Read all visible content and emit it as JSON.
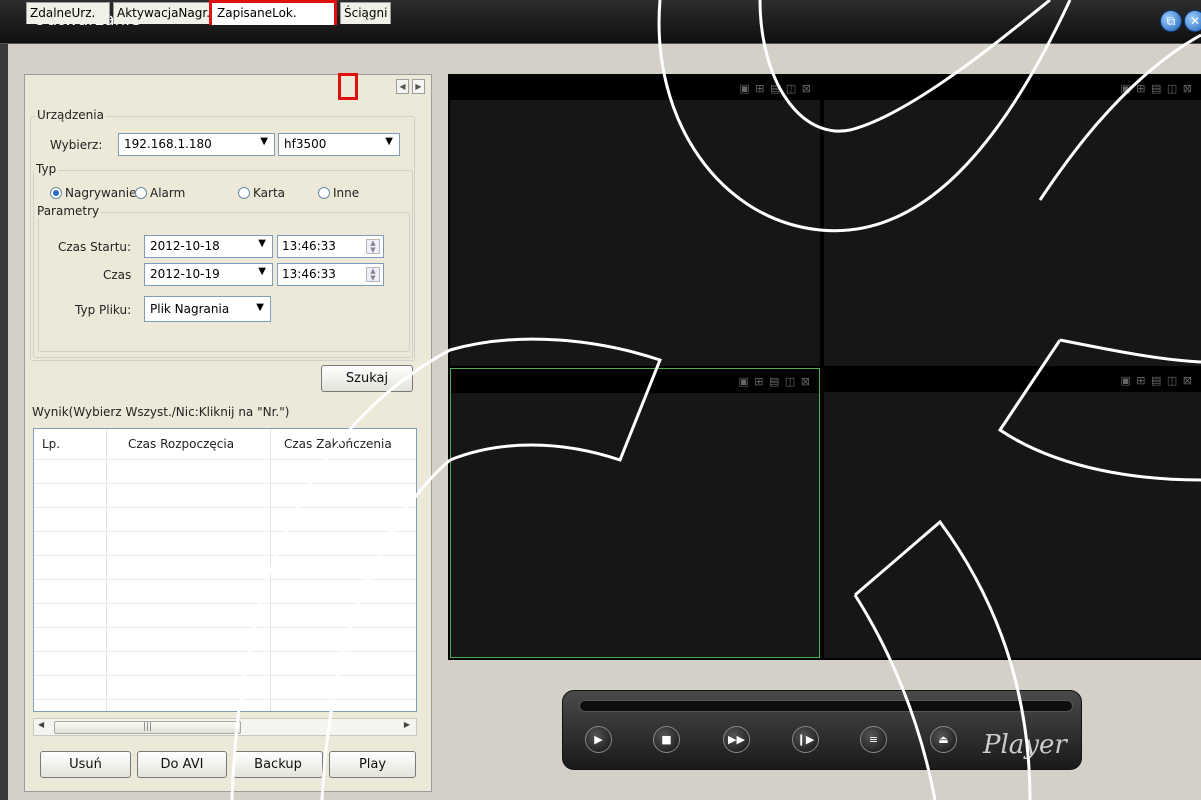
{
  "window": {
    "title": "Odtwarzanie"
  },
  "tabs": [
    "ZdalneUrz.",
    "AktywacjaNagr.",
    "ZapisaneLok.",
    "Ściągni"
  ],
  "devices": {
    "group_label": "Urządzenia",
    "select_label": "Wybierz:",
    "device_ip": "192.168.1.180",
    "device_name": "hf3500"
  },
  "type": {
    "group_label": "Typ",
    "options": [
      "Nagrywanie",
      "Alarm",
      "Karta",
      "Inne"
    ],
    "selected": "Nagrywanie"
  },
  "params": {
    "group_label": "Parametry",
    "start_label": "Czas Startu:",
    "start_date": "2012-10-18",
    "start_time": "13:46:33",
    "end_label": "Czas",
    "end_date": "2012-10-19",
    "end_time": "13:46:33",
    "filetype_label": "Typ Pliku:",
    "filetype": "Plik Nagrania"
  },
  "search_button": "Szukaj",
  "results": {
    "label": "Wynik(Wybierz Wszyst./Nic:Kliknij na \"Nr.\")",
    "columns": [
      "Lp.",
      "Czas Rozpoczęcia",
      "Czas Zakończenia"
    ]
  },
  "buttons": {
    "delete": "Usuń",
    "avi": "Do AVI",
    "backup": "Backup",
    "play": "Play"
  },
  "player": {
    "logo": "Player"
  },
  "colors": {
    "accent_red": "#e01010",
    "active_panel": "#4caf50"
  }
}
